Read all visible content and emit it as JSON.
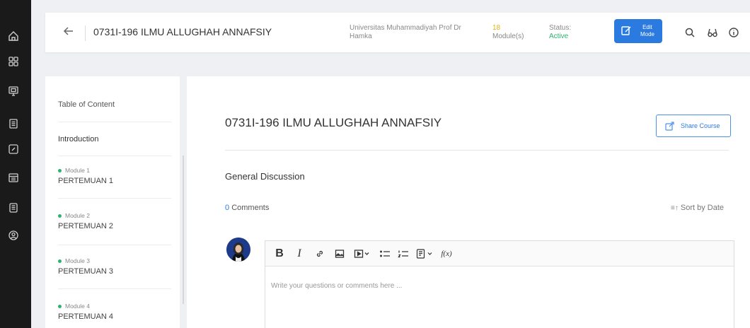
{
  "header": {
    "course_title": "0731I-196 ILMU ALLUGHAH ANNAFSIY",
    "university": "Universitas Muhammadiyah Prof Dr Hamka",
    "modules_count": "18",
    "modules_label": "Module(s)",
    "status_label": "Status:",
    "status_value": "Active",
    "edit_mode_label": "Edit Mode"
  },
  "toc": {
    "header": "Table of Content",
    "intro": "Introduction",
    "items": [
      {
        "module": "Module 1",
        "name": "PERTEMUAN 1"
      },
      {
        "module": "Module 2",
        "name": "PERTEMUAN 2"
      },
      {
        "module": "Module 3",
        "name": "PERTEMUAN 3"
      },
      {
        "module": "Module 4",
        "name": "PERTEMUAN 4"
      }
    ]
  },
  "main": {
    "title": "0731I-196 ILMU ALLUGHAH ANNAFSIY",
    "share_label": "Share Course",
    "discussion_title": "General Discussion",
    "comments_count": "0",
    "comments_label": "Comments",
    "sort_label": "Sort by Date",
    "editor_placeholder": "Write your questions or comments here ..."
  },
  "icons": {
    "rail": [
      "home-icon",
      "dashboard-icon",
      "monitor-icon",
      "list-icon",
      "edit-icon",
      "calendar-icon",
      "document-icon",
      "profile-icon"
    ],
    "toolbar": [
      "bold-icon",
      "italic-icon",
      "link-icon",
      "image-icon",
      "media-icon",
      "bullet-list-icon",
      "numbered-list-icon",
      "file-icon",
      "formula-icon"
    ]
  },
  "colors": {
    "accent": "#2b7ae0",
    "active": "#2db36b",
    "module_count": "#e4b21a"
  }
}
